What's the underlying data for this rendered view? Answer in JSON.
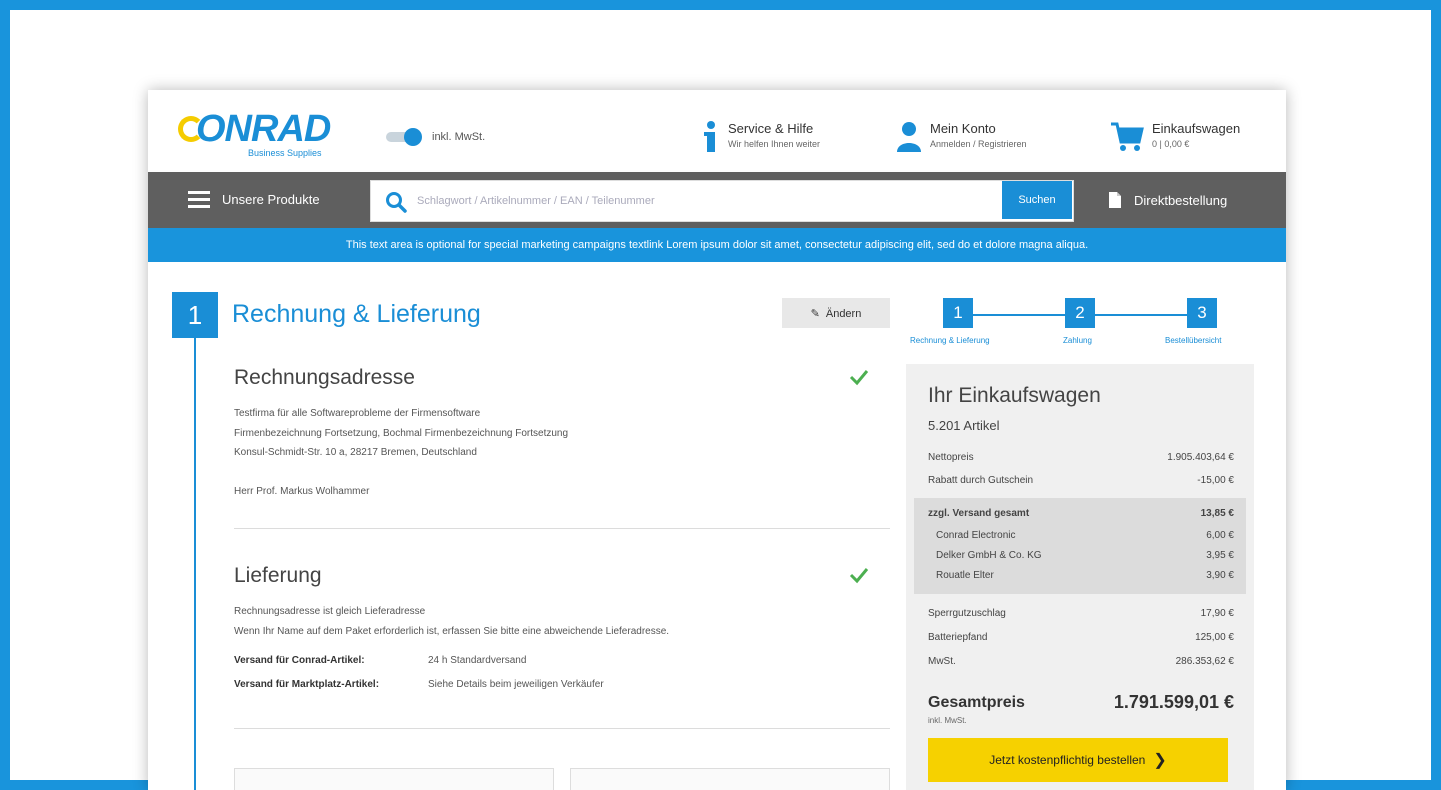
{
  "header": {
    "logo_text": "ONRAD",
    "logo_subtitle": "Business Supplies",
    "toggle_label": "inkl. MwSt.",
    "service": {
      "title": "Service & Hilfe",
      "subtitle": "Wir helfen Ihnen weiter"
    },
    "account": {
      "title": "Mein Konto",
      "subtitle": "Anmelden / Registrieren"
    },
    "cart": {
      "title": "Einkaufswagen",
      "subtitle": "0 | 0,00 €"
    }
  },
  "nav": {
    "menu_label": "Unsere Produkte",
    "search_placeholder": "Schlagwort / Artikelnummer / EAN / Teilenummer",
    "search_button": "Suchen",
    "direct_order": "Direktbestellung"
  },
  "promo_text": "This text area is optional for special marketing campaigns textlink Lorem ipsum dolor sit amet, consectetur adipiscing elit, sed do et dolore magna aliqua.",
  "main": {
    "step_number": "1",
    "title": "Rechnung & Lieferung",
    "edit_button": "Ändern",
    "billing": {
      "heading": "Rechnungsadresse",
      "lines": [
        "Testfirma für alle Softwareprobleme der Firmensoftware",
        "Firmenbezeichnung Fortsetzung, Bochmal Firmenbezeichnung Fortsetzung",
        "Konsul-Schmidt-Str. 10 a, 28217 Bremen, Deutschland",
        "Herr Prof. Markus Wolhammer"
      ]
    },
    "delivery": {
      "heading": "Lieferung",
      "lines": [
        "Rechnungsadresse ist gleich Lieferadresse",
        "Wenn Ihr Name auf dem Paket erforderlich ist, erfassen Sie bitte eine abweichende Lieferadresse."
      ],
      "shipping": [
        {
          "label": "Versand für Conrad-Artikel:",
          "value": "24 h Standardversand"
        },
        {
          "label": "Versand für Marktplatz-Artikel:",
          "value": "Siehe Details beim jeweiligen Verkäufer"
        }
      ]
    }
  },
  "progress": {
    "steps": [
      {
        "number": "1",
        "label": "Rechnung & Lieferung"
      },
      {
        "number": "2",
        "label": "Zahlung"
      },
      {
        "number": "3",
        "label": "Bestellübersicht"
      }
    ]
  },
  "cart_panel": {
    "title": "Ihr Einkaufswagen",
    "count": "5.201 Artikel",
    "net_label": "Nettopreis",
    "net_value": "1.905.403,64 €",
    "discount_label": "Rabatt durch Gutschein",
    "discount_value": "-15,00 €",
    "shipping_total_label": "zzgl. Versand gesamt",
    "shipping_total_value": "13,85 €",
    "shipping_items": [
      {
        "label": "Conrad Electronic",
        "value": "6,00 €"
      },
      {
        "label": "Delker GmbH & Co. KG",
        "value": "3,95 €"
      },
      {
        "label": "Rouatle Elter",
        "value": "3,90 €"
      }
    ],
    "bulky_label": "Sperrgutzuschlag",
    "bulky_value": "17,90 €",
    "battery_label": "Batteriepfand",
    "battery_value": "125,00 €",
    "vat_label": "MwSt.",
    "vat_value": "286.353,62 €",
    "total_label": "Gesamtpreis",
    "total_note": "inkl. MwSt.",
    "total_value": "1.791.599,01 €",
    "order_button": "Jetzt kostenpflichtig bestellen"
  },
  "colors": {
    "brand_blue": "#1a8ed6",
    "frame_blue": "#1994dc",
    "nav_gray": "#5f5f5f",
    "cta_yellow": "#f6d100",
    "check_green": "#4caf50"
  },
  "icons": {
    "service": "info-icon",
    "account": "user-icon",
    "cart": "cart-icon",
    "menu": "hamburger-icon",
    "search": "search-icon",
    "direct_order": "document-icon",
    "edit": "pencil-icon",
    "check": "check-icon",
    "order_chevron": "chevron-right-icon"
  }
}
